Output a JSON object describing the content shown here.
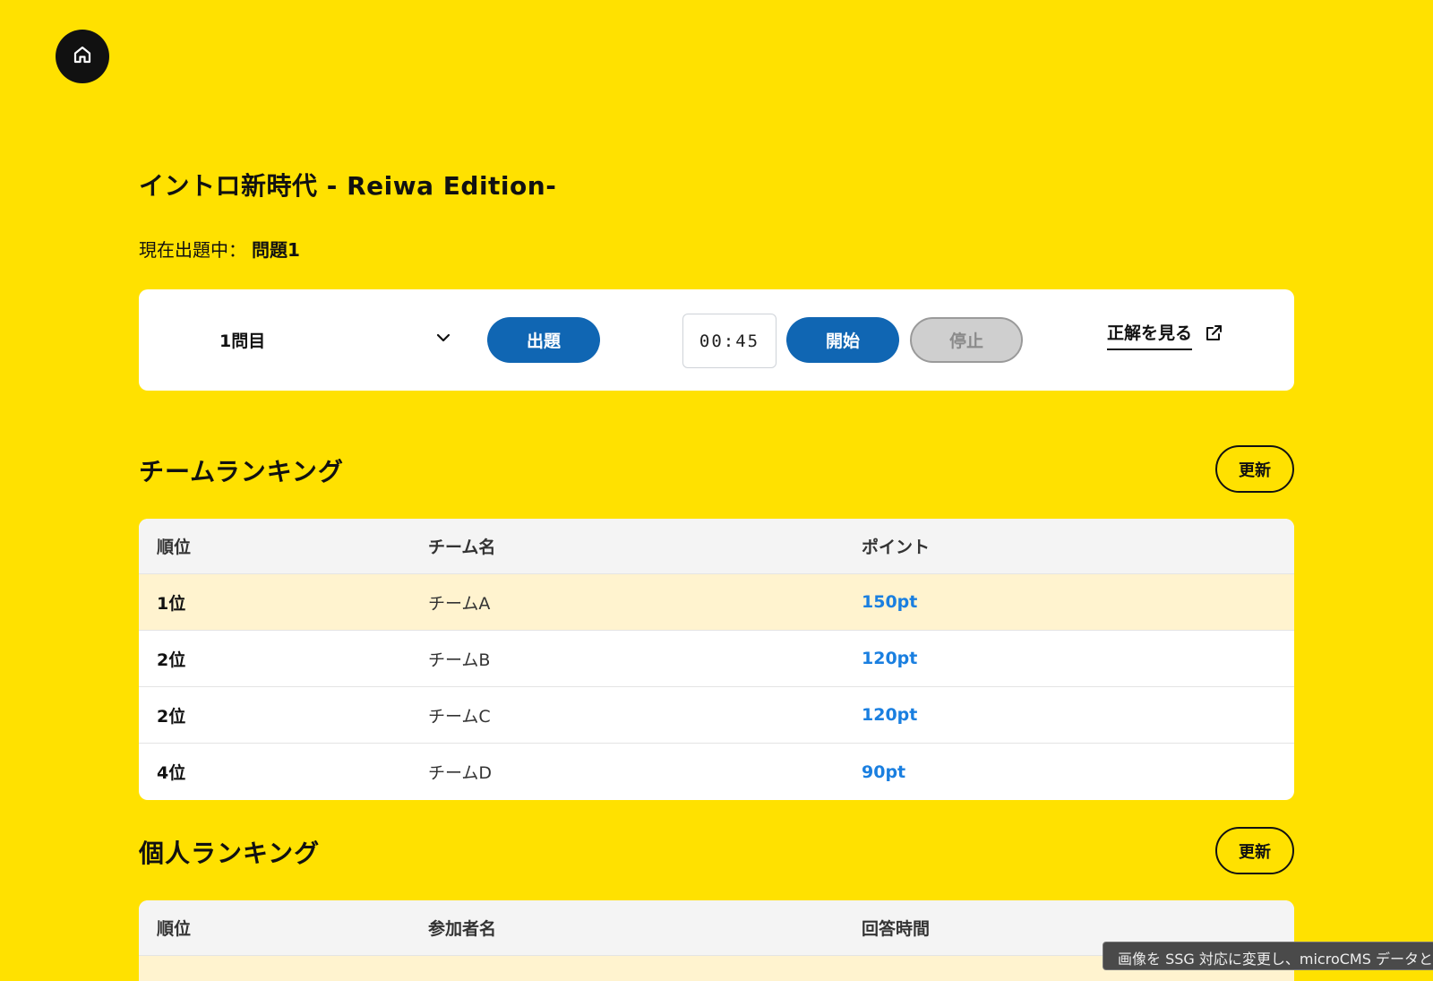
{
  "home": {
    "icon": "home-icon"
  },
  "header": {
    "title": "イントロ新時代 - Reiwa Edition-",
    "current_label": "現在出題中：",
    "current_value": "問題1"
  },
  "controls": {
    "question_select": {
      "value": "1問目",
      "icon": "chevron-down-icon"
    },
    "ask_label": "出題",
    "timer": "00:45",
    "start_label": "開始",
    "stop_label": "停止",
    "answer_label": "正解を見る",
    "answer_icon": "external-link-icon",
    "accent_color": "#1066b3"
  },
  "team_ranking": {
    "title": "チームランキング",
    "refresh_label": "更新",
    "headers": [
      "順位",
      "チーム名",
      "ポイント"
    ],
    "rows": [
      {
        "rank": "1位",
        "name": "チームA",
        "points": "150pt"
      },
      {
        "rank": "2位",
        "name": "チームB",
        "points": "120pt"
      },
      {
        "rank": "2位",
        "name": "チームC",
        "points": "120pt"
      },
      {
        "rank": "4位",
        "name": "チームD",
        "points": "90pt"
      }
    ]
  },
  "individual_ranking": {
    "title": "個人ランキング",
    "refresh_label": "更新",
    "headers": [
      "順位",
      "参加者名",
      "回答時間"
    ]
  },
  "toast": {
    "text": "画像を SSG 対応に変更し、microCMS データと"
  },
  "colors": {
    "background": "#ffe100",
    "highlight_row": "#fff3cf",
    "points": "#1a7fe0"
  }
}
